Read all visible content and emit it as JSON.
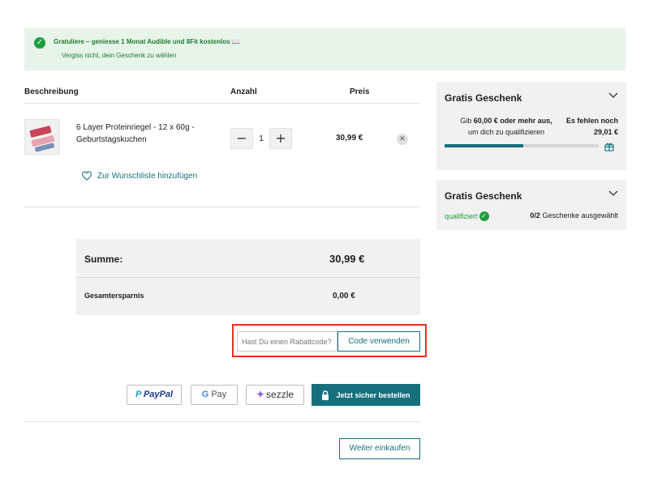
{
  "banner": {
    "title": "Gratuliere – geniesse 1 Monat Audible und 8Fit kostenlos 📖",
    "subtitle": "Vergiss nicht, dein Geschenk zu wählen"
  },
  "cart": {
    "headers": {
      "description": "Beschreibung",
      "quantity": "Anzahl",
      "price": "Preis"
    },
    "item": {
      "name": "6 Layer Proteinriegel - 12 x 60g - Geburtstagskuchen",
      "quantity": "1",
      "price": "30,99 €",
      "wishlist_label": "Zur Wunschliste hinzufügen"
    }
  },
  "summary": {
    "sum_label": "Summe:",
    "sum_value": "30,99 €",
    "savings_label": "Gesamtersparnis",
    "savings_value": "0,00 €"
  },
  "coupon": {
    "placeholder": "Hast Du einen Rabattcode?",
    "button_label": "Code verwenden"
  },
  "payment": {
    "paypal_label": "PayPal",
    "gpay_label": "Pay",
    "sezzle_label": "sezzle",
    "order_label": "Jetzt sicher bestellen"
  },
  "continue_label": "Weiter einkaufen",
  "gift_panel_1": {
    "title": "Gratis Geschenk",
    "message_pre": "Gib ",
    "message_amount": "60,00 € oder mehr aus,",
    "message_post": "um dich zu qualifizieren",
    "missing_label": "Es fehlen noch 29,01 €",
    "progress": 0.51
  },
  "gift_panel_2": {
    "title": "Gratis Geschenk",
    "qualified_label": "qualifiziert",
    "selected_count": "0/2",
    "selected_label": " Geschenke ausgewählt"
  },
  "colors": {
    "accent": "#15707c",
    "success": "#1f9d3f",
    "banner_bg": "#e6f4e9",
    "highlight": "#e0331f"
  }
}
